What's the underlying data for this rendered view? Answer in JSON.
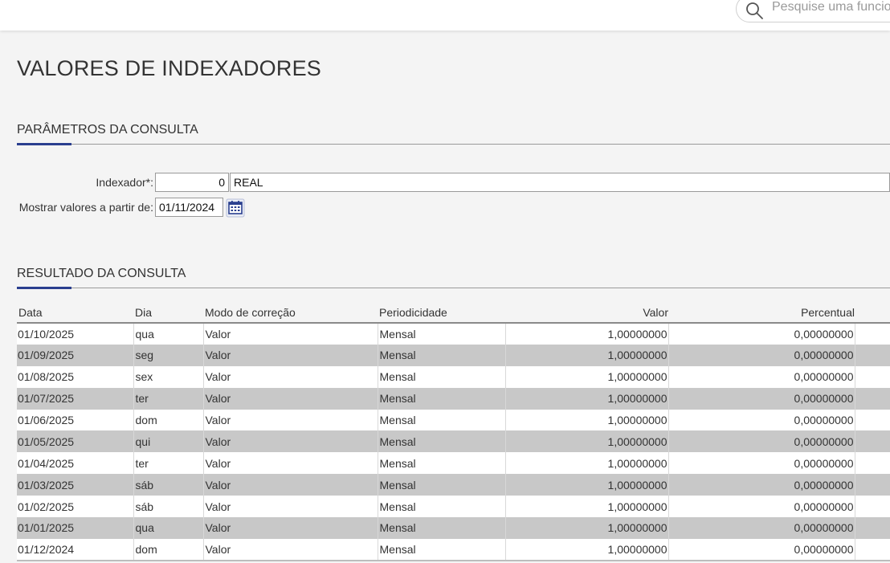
{
  "search": {
    "placeholder": "Pesquise uma funcionalidade"
  },
  "page": {
    "title": "VALORES DE INDEXADORES"
  },
  "params": {
    "title": "PARÂMETROS DA CONSULTA",
    "indexador_label": "Indexador*:",
    "indexador_code": "0",
    "indexador_name": "REAL",
    "date_label": "Mostrar valores a partir de:",
    "date_value": "01/11/2024"
  },
  "results": {
    "title": "RESULTADO DA CONSULTA",
    "columns": [
      "Data",
      "Dia",
      "Modo de correção",
      "Periodicidade",
      "Valor",
      "Percentual"
    ],
    "rows": [
      [
        "01/10/2025",
        "qua",
        "Valor",
        "Mensal",
        "1,00000000",
        "0,00000000"
      ],
      [
        "01/09/2025",
        "seg",
        "Valor",
        "Mensal",
        "1,00000000",
        "0,00000000"
      ],
      [
        "01/08/2025",
        "sex",
        "Valor",
        "Mensal",
        "1,00000000",
        "0,00000000"
      ],
      [
        "01/07/2025",
        "ter",
        "Valor",
        "Mensal",
        "1,00000000",
        "0,00000000"
      ],
      [
        "01/06/2025",
        "dom",
        "Valor",
        "Mensal",
        "1,00000000",
        "0,00000000"
      ],
      [
        "01/05/2025",
        "qui",
        "Valor",
        "Mensal",
        "1,00000000",
        "0,00000000"
      ],
      [
        "01/04/2025",
        "ter",
        "Valor",
        "Mensal",
        "1,00000000",
        "0,00000000"
      ],
      [
        "01/03/2025",
        "sáb",
        "Valor",
        "Mensal",
        "1,00000000",
        "0,00000000"
      ],
      [
        "01/02/2025",
        "sáb",
        "Valor",
        "Mensal",
        "1,00000000",
        "0,00000000"
      ],
      [
        "01/01/2025",
        "qua",
        "Valor",
        "Mensal",
        "1,00000000",
        "0,00000000"
      ],
      [
        "01/12/2024",
        "dom",
        "Valor",
        "Mensal",
        "1,00000000",
        "0,00000000"
      ]
    ]
  },
  "colors": {
    "accent": "#2a3f8f",
    "row_alt": "#c8c8c8"
  },
  "icons": {
    "search": "search-icon",
    "calendar": "calendar-icon"
  }
}
